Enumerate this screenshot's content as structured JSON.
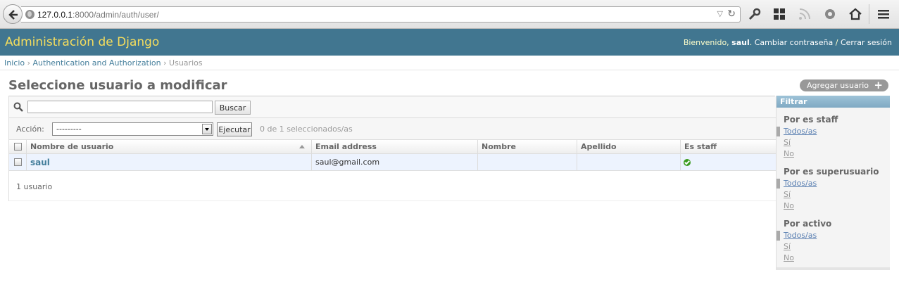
{
  "browser": {
    "url_host": "127.0.0.1",
    "url_path": ":8000/admin/auth/user/"
  },
  "header": {
    "branding": "Administración de Django",
    "welcome": "Bienvenido,",
    "username": "saul",
    "separator": ".",
    "change_password": "Cambiar contraseña",
    "slash": "/",
    "logout": "Cerrar sesión"
  },
  "breadcrumbs": {
    "home": "Inicio",
    "sep1": "›",
    "app": "Authentication and Authorization",
    "sep2": "›",
    "current": "Usuarios"
  },
  "page": {
    "title": "Seleccione usuario a modificar",
    "add_button": "Agregar usuario"
  },
  "search": {
    "value": "",
    "button": "Buscar"
  },
  "actions": {
    "label": "Acción:",
    "selected": "---------",
    "execute": "Ejecutar",
    "counter": "0 de 1 seleccionados/as"
  },
  "table": {
    "columns": [
      "Nombre de usuario",
      "Email address",
      "Nombre",
      "Apellido",
      "Es staff"
    ],
    "rows": [
      {
        "username": "saul",
        "email": "saul@gmail.com",
        "first_name": "",
        "last_name": "",
        "is_staff": true
      }
    ],
    "paginator": "1 usuario"
  },
  "filter": {
    "title": "Filtrar",
    "groups": [
      {
        "title": "Por es staff",
        "options": [
          "Todos/as",
          "Sí",
          "No"
        ]
      },
      {
        "title": "Por es superusuario",
        "options": [
          "Todos/as",
          "Sí",
          "No"
        ]
      },
      {
        "title": "Por activo",
        "options": [
          "Todos/as",
          "Sí",
          "No"
        ]
      }
    ]
  },
  "colors": {
    "header_bg": "#417690",
    "branding": "#f5dd5d",
    "link": "#447e9b",
    "row_selected": "#edf3fe",
    "staff_check": "#3b9b1e"
  }
}
